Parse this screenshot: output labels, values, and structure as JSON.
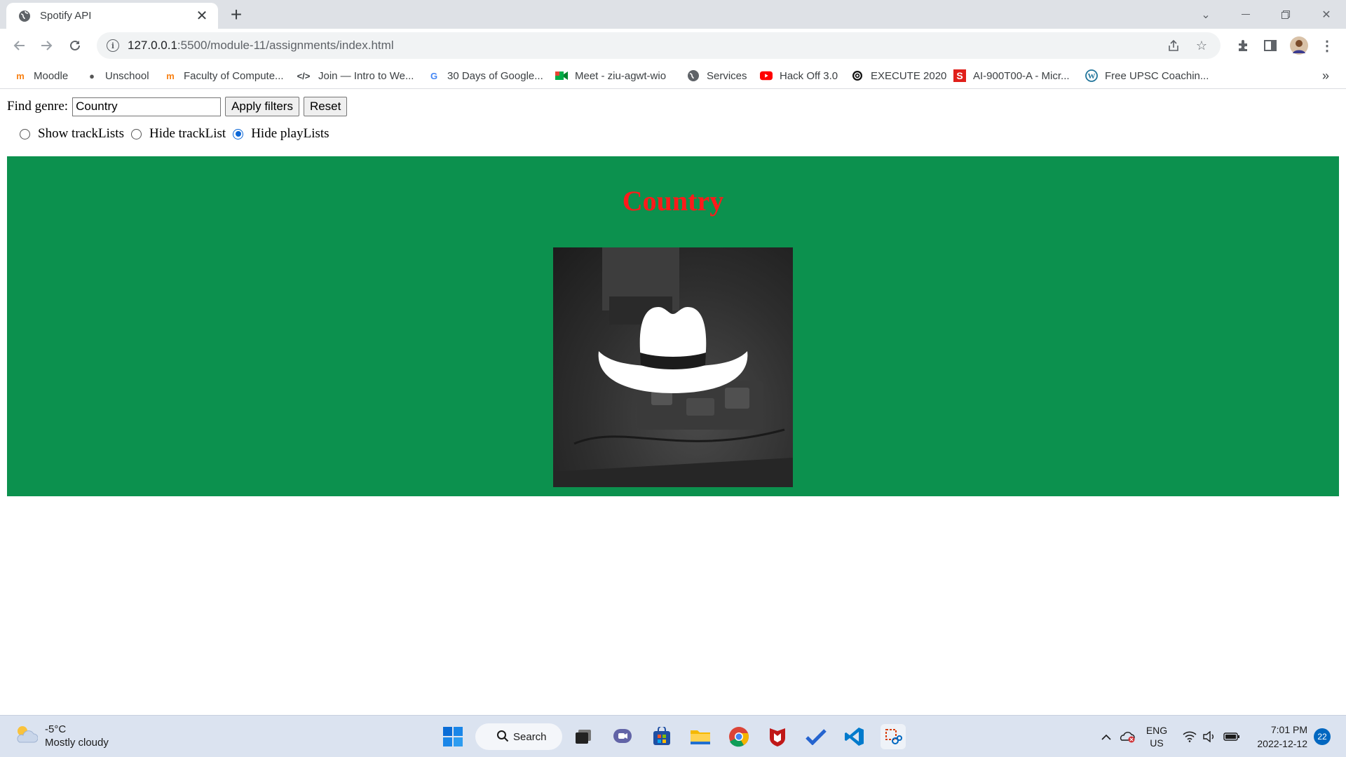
{
  "browser": {
    "tab_title": "Spotify API",
    "url_host": "127.0.0.1",
    "url_rest": ":5500/module-11/assignments/index.html",
    "bookmarks": [
      {
        "label": "Moodle",
        "icon": "moodle-icon"
      },
      {
        "label": "Unschool",
        "icon": "apple-icon"
      },
      {
        "label": "Faculty of Compute...",
        "icon": "moodle-icon"
      },
      {
        "label": "Join — Intro to We...",
        "icon": "code-icon"
      },
      {
        "label": "30 Days of Google...",
        "icon": "google-icon"
      },
      {
        "label": "Meet - ziu-agwt-wio",
        "icon": "meet-icon"
      },
      {
        "label": "Services",
        "icon": "globe-icon"
      },
      {
        "label": "Hack Off 3.0",
        "icon": "youtube-icon"
      },
      {
        "label": "EXECUTE 2020",
        "icon": "spiral-icon"
      },
      {
        "label": "AI-900T00-A - Micr...",
        "icon": "s-icon"
      },
      {
        "label": "Free UPSC Coachin...",
        "icon": "wordpress-icon"
      }
    ],
    "more_bookmarks": "»"
  },
  "page": {
    "find_label": "Find genre:",
    "genre_value": "Country",
    "apply_label": "Apply filters",
    "reset_label": "Reset",
    "radios": [
      {
        "label": "Show trackLists",
        "checked": false
      },
      {
        "label": "Hide trackList",
        "checked": false
      },
      {
        "label": "Hide playLists",
        "checked": true
      }
    ],
    "card_title": "Country",
    "colors": {
      "card_bg": "#0c914e",
      "title": "#ff1a1a",
      "radio_accent": "#0b66d6"
    }
  },
  "taskbar": {
    "temperature": "-5°C",
    "weather": "Mostly cloudy",
    "search_label": "Search",
    "lang": "ENG",
    "region": "US",
    "time": "7:01 PM",
    "date": "2022-12-12",
    "notifications": "22"
  }
}
